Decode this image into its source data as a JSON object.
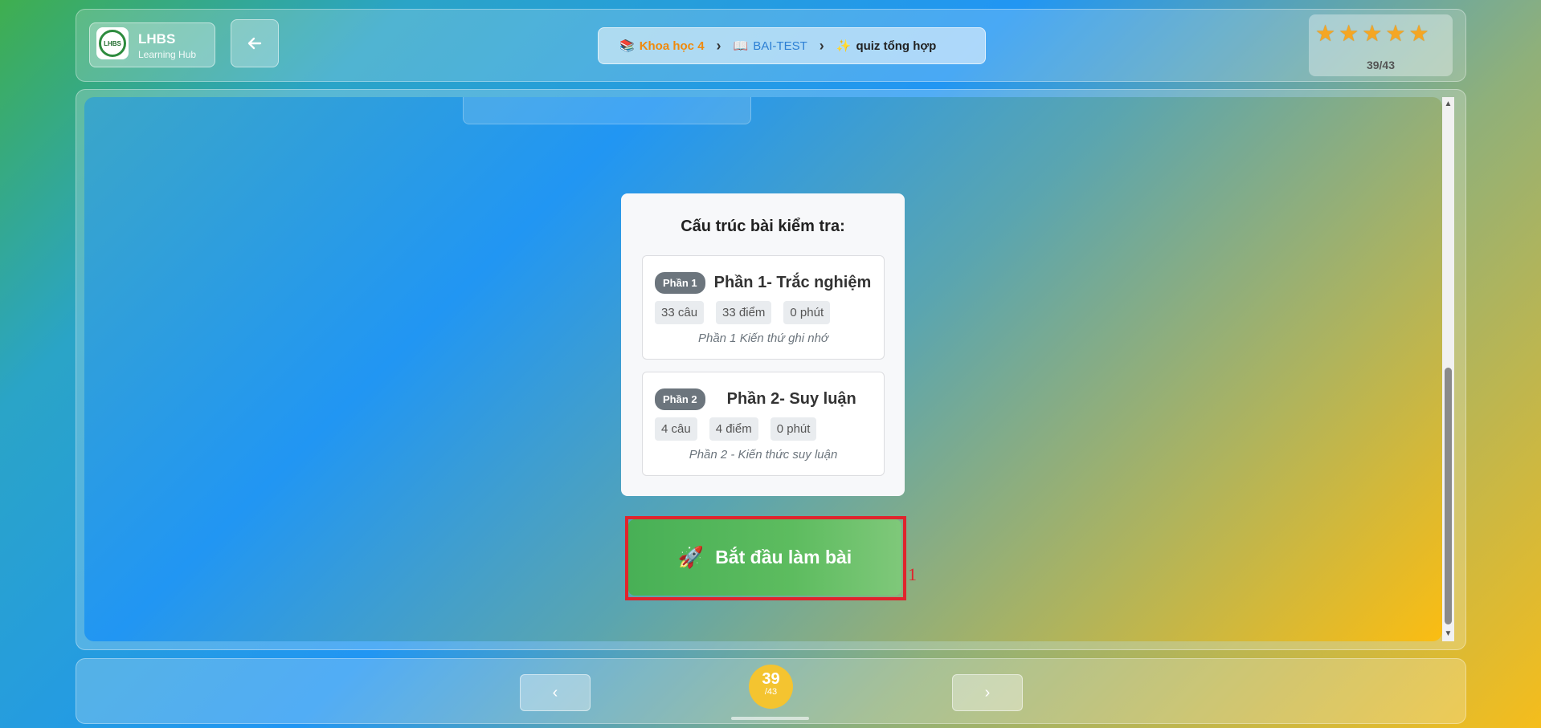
{
  "header": {
    "logo_badge_text": "LHBS",
    "app_name": "LHBS",
    "app_subtitle": "Learning Hub",
    "back_icon": "arrow-left-icon",
    "breadcrumb": [
      {
        "icon": "books-emoji",
        "glyph": "📚",
        "label": "Khoa học 4",
        "color": "#f08a0c"
      },
      {
        "icon": "open-book-emoji",
        "glyph": "📖",
        "label": "BAI-TEST",
        "color": "#2c7fd4"
      },
      {
        "icon": "sparkles-emoji",
        "glyph": "✨",
        "label": "quiz tổng hợp",
        "color": "#222222"
      }
    ],
    "stars_count": 5,
    "progress_text": "39/43"
  },
  "quiz_structure": {
    "title": "Cấu trúc bài kiểm tra:",
    "sections": [
      {
        "badge": "Phần 1",
        "title": "Phần 1- Trắc nghiệm",
        "questions": "33 câu",
        "points": "33 điểm",
        "duration": "0 phút",
        "description": "Phần 1 Kiến thứ ghi nhớ"
      },
      {
        "badge": "Phần 2",
        "title": "Phần 2- Suy luận",
        "questions": "4 câu",
        "points": "4 điểm",
        "duration": "0 phút",
        "description": "Phần 2 - Kiến thức suy luận"
      }
    ]
  },
  "start_button": {
    "label": "Bắt đầu làm bài",
    "icon": "rocket-emoji",
    "annotation_number": "1"
  },
  "footer": {
    "prev_label": "‹",
    "next_label": "›",
    "current_page": "39",
    "total_pages": "/43"
  },
  "colors": {
    "accent_green": "#48b056",
    "highlight_red": "#e0242c",
    "page_circle": "#f4c430",
    "badge_gray": "#6c757d"
  }
}
